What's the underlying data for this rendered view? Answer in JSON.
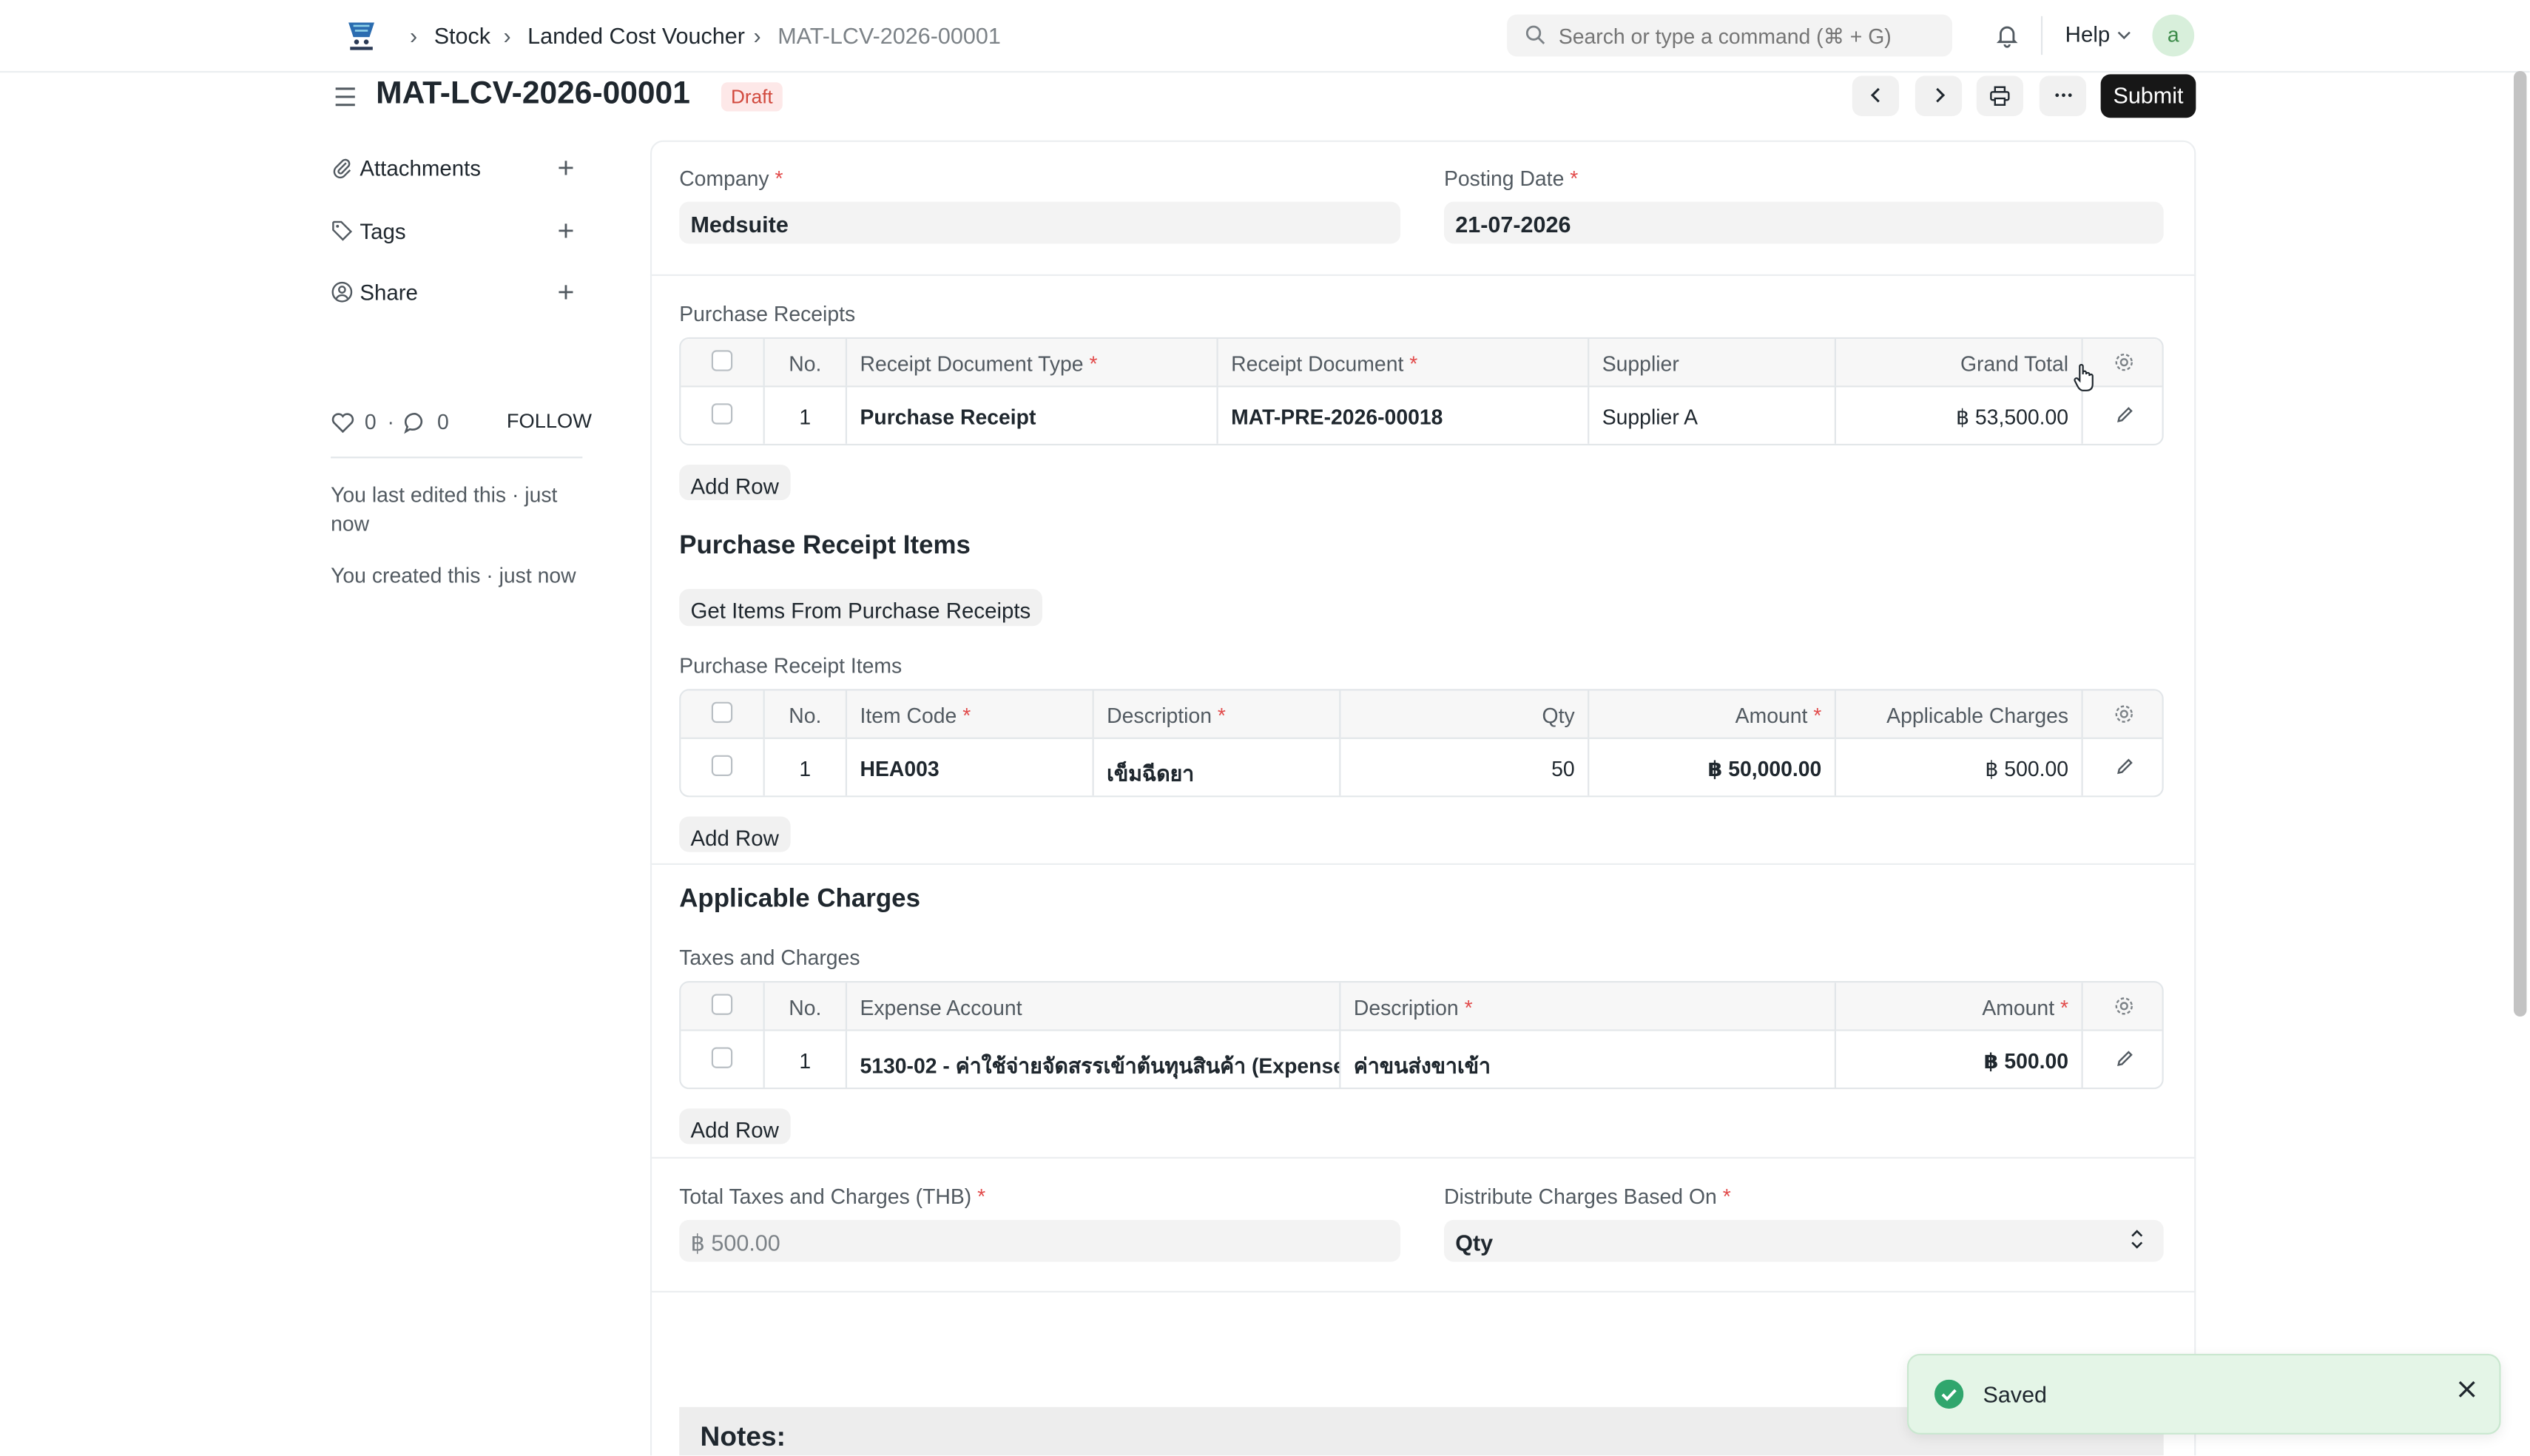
{
  "breadcrumbs": [
    "Stock",
    "Landed Cost Voucher",
    "MAT-LCV-2026-00001"
  ],
  "search": {
    "placeholder": "Search or type a command (⌘ + G)"
  },
  "help_label": "Help",
  "user_initial": "a",
  "page": {
    "title": "MAT-LCV-2026-00001",
    "status": "Draft",
    "submit_label": "Submit"
  },
  "sidebar": {
    "attachments": "Attachments",
    "tags": "Tags",
    "share": "Share",
    "likes": "0",
    "comments": "0",
    "follow": "FOLLOW",
    "last_edited": "You last edited this · just now",
    "created": "You created this · just now"
  },
  "form": {
    "company_label": "Company",
    "company_value": "Medsuite",
    "posting_date_label": "Posting Date",
    "posting_date_value": "21-07-2026",
    "purchase_receipts_label": "Purchase Receipts",
    "purchase_receipts": {
      "headers": [
        "No.",
        "Receipt Document Type",
        "Receipt Document",
        "Supplier",
        "Grand Total"
      ],
      "rows": [
        {
          "no": "1",
          "type": "Purchase Receipt",
          "document": "MAT-PRE-2026-00018",
          "supplier": "Supplier A",
          "grand_total": "฿ 53,500.00"
        }
      ]
    },
    "add_row": "Add Row",
    "items_section_title": "Purchase Receipt Items",
    "get_items_button": "Get Items From Purchase Receipts",
    "items_label": "Purchase Receipt Items",
    "items": {
      "headers": [
        "No.",
        "Item Code",
        "Description",
        "Qty",
        "Amount",
        "Applicable Charges"
      ],
      "rows": [
        {
          "no": "1",
          "item_code": "HEA003",
          "description": "เข็มฉีดยา",
          "qty": "50",
          "amount": "฿ 50,000.00",
          "charges": "฿ 500.00"
        }
      ]
    },
    "charges_section_title": "Applicable Charges",
    "taxes_label": "Taxes and Charges",
    "taxes": {
      "headers": [
        "No.",
        "Expense Account",
        "Description",
        "Amount"
      ],
      "rows": [
        {
          "no": "1",
          "account": "5130-02 - ค่าใช้จ่ายจัดสรรเข้าต้นทุนสินค้า (Expense...",
          "description": "ค่าขนส่งขาเข้า",
          "amount": "฿ 500.00"
        }
      ]
    },
    "total_taxes_label": "Total Taxes and Charges (THB)",
    "total_taxes_value": "฿ 500.00",
    "distribute_label": "Distribute Charges Based On",
    "distribute_value": "Qty",
    "notes_label": "Notes:"
  },
  "toast": {
    "message": "Saved"
  },
  "colors": {
    "accent": "#171717",
    "draft_badge": "#d1493d",
    "toast_bg": "#e4f5e7",
    "success": "#30a66d"
  }
}
